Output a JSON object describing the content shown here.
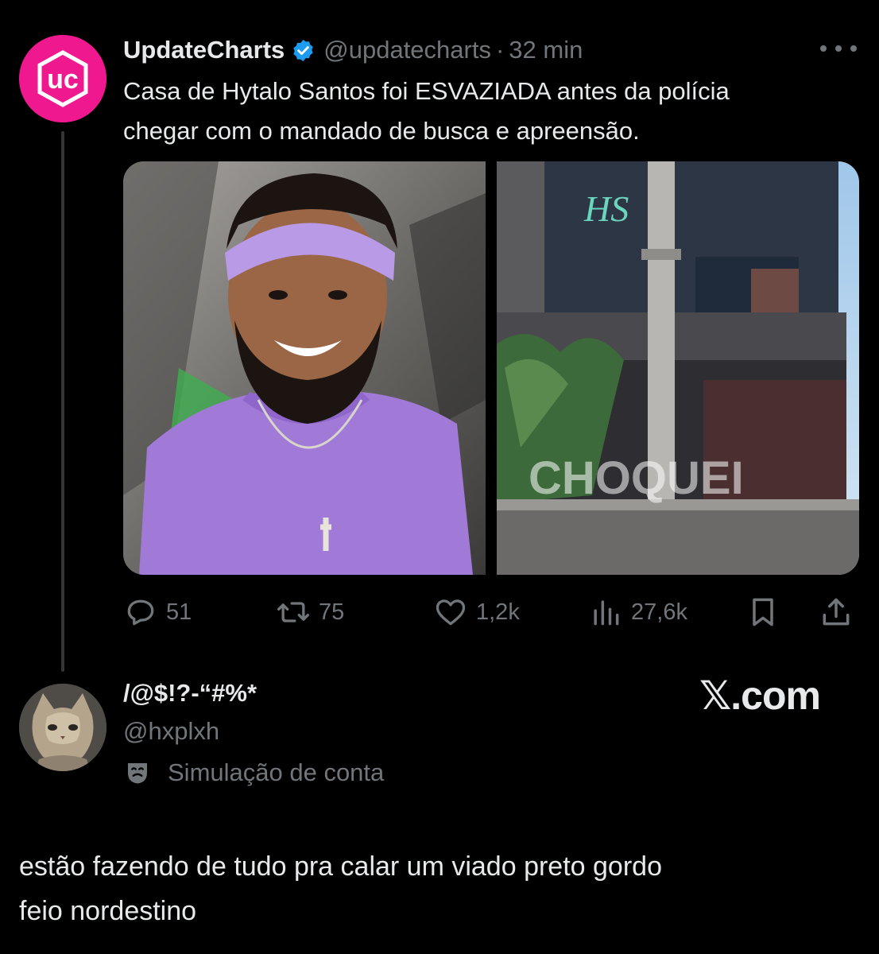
{
  "tweet": {
    "display_name": "UpdateCharts",
    "handle": "@updatecharts",
    "separator": "·",
    "time": "32 min",
    "avatar_text": "uc",
    "verified_icon": "verified-badge-icon",
    "text_lines": [
      "Casa de Hytalo Santos foi ESVAZIADA antes da polícia",
      "chegar com o mandado de busca e apreensão."
    ],
    "media": {
      "left_image": "smiling man with purple headband and purple shirt",
      "right_image": "dark modern house with HS logo on facade",
      "watermark": "CHOQUEI",
      "logo_text": "HS"
    },
    "actions": {
      "replies": "51",
      "retweets": "75",
      "likes": "1,2k",
      "views": "27,6k"
    },
    "accent_color": "#1d9bf0",
    "brand_color": "#f0188f"
  },
  "reply_user": {
    "display_name": "/@$!?-“#%*",
    "handle": "@hxplxh",
    "parody_label": "Simulação de conta",
    "site": "𝕏.com"
  },
  "reply": {
    "text_lines": [
      "estão fazendo de tudo pra calar um viado preto gordo",
      "feio nordestino"
    ]
  }
}
